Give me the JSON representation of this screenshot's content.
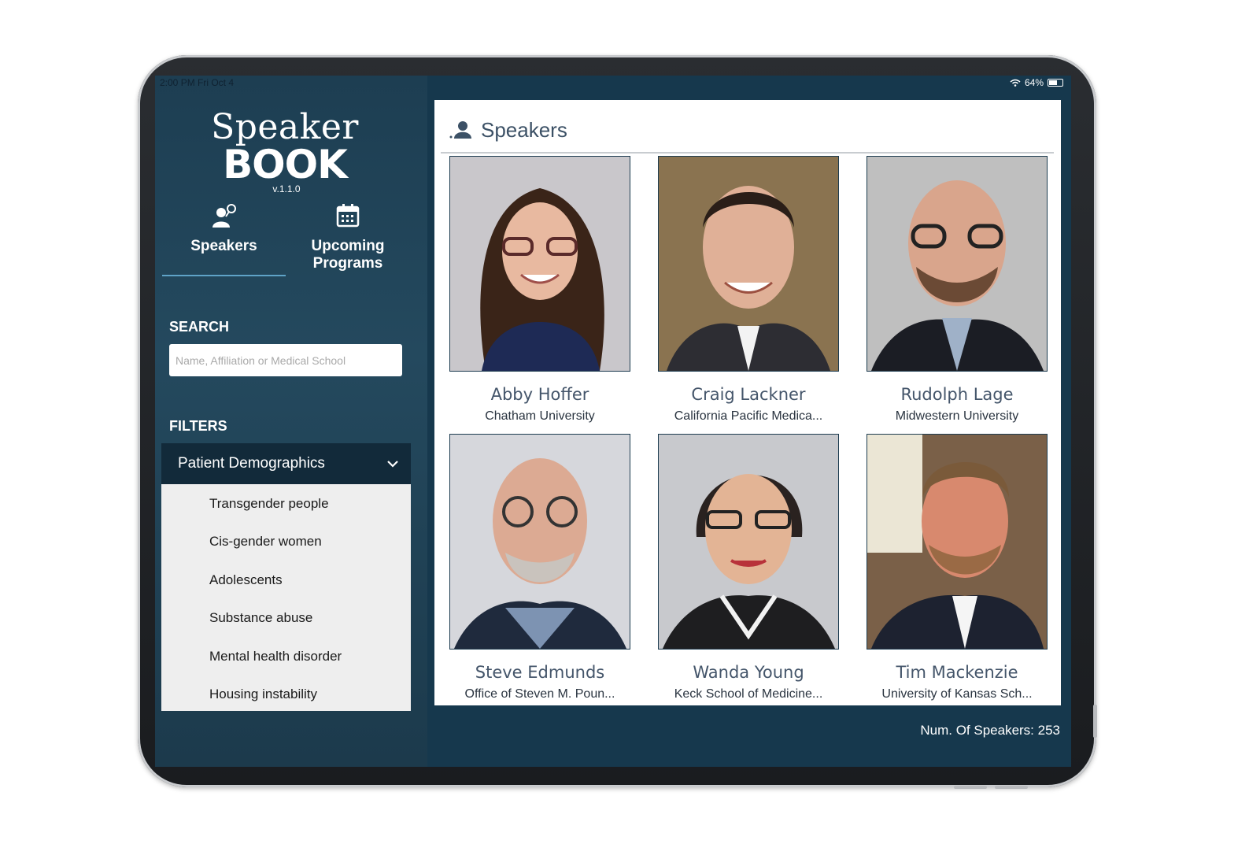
{
  "status": {
    "time": "2:00 PM   Fri Oct 4",
    "battery": "64%"
  },
  "logo": {
    "top": "Speaker",
    "bottom": "BOOK",
    "version": "v.1.1.0"
  },
  "nav": {
    "speakers": "Speakers",
    "upcoming_line1": "Upcoming",
    "upcoming_line2": "Programs"
  },
  "search": {
    "label": "SEARCH",
    "placeholder": "Name, Affiliation or Medical School"
  },
  "filters": {
    "label": "FILTERS",
    "group": "Patient Demographics",
    "items": [
      "Transgender people",
      "Cis-gender women",
      "Adolescents",
      "Substance abuse",
      "Mental health disorder",
      "Housing instability"
    ]
  },
  "main": {
    "title": "Speakers",
    "speakers": [
      {
        "name": "Abby Hoffer",
        "affiliation": "Chatham University"
      },
      {
        "name": "Craig Lackner",
        "affiliation": "California Pacific Medica..."
      },
      {
        "name": "Rudolph Lage",
        "affiliation": "Midwestern University"
      },
      {
        "name": "Steve Edmunds",
        "affiliation": "Office of Steven M. Poun..."
      },
      {
        "name": "Wanda Young",
        "affiliation": "Keck School of Medicine..."
      },
      {
        "name": "Tim Mackenzie",
        "affiliation": "University of Kansas Sch..."
      }
    ],
    "count": "Num. Of Speakers: 253"
  },
  "colors": {
    "sidebar": "#1d3e52",
    "filter_header": "#122a3a",
    "accent": "#5fa3c7",
    "name_text": "#44556a"
  }
}
